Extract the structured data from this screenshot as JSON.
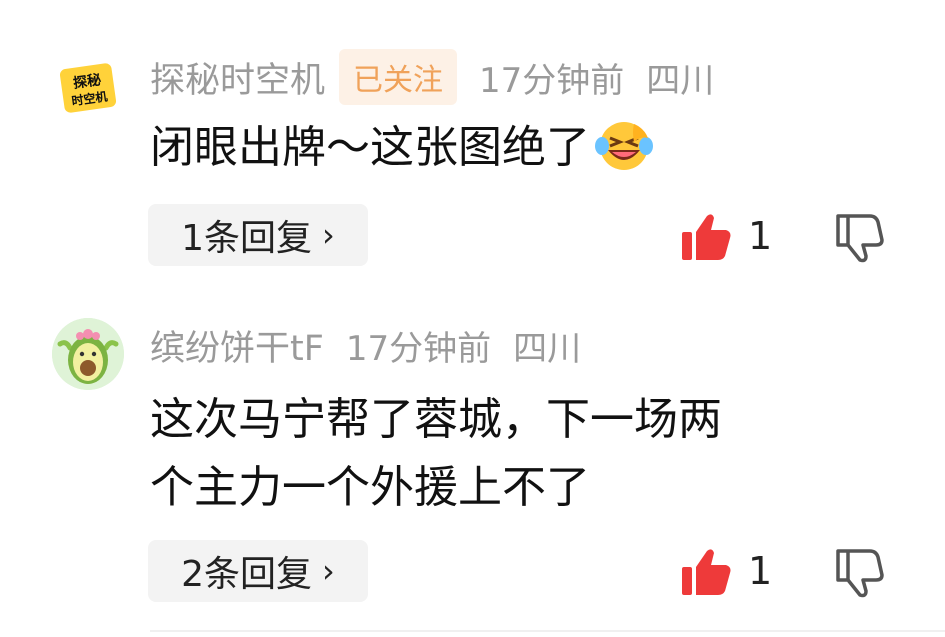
{
  "comments": [
    {
      "username": "探秘时空机",
      "avatar_text": [
        "探秘",
        "时空机"
      ],
      "follow_badge": "已关注",
      "time": "17分钟前",
      "location": "四川",
      "text": "闭眼出牌～这张图绝了",
      "emoji": "laughing-crying-emoji",
      "reply_label": "1条回复",
      "likes": "1"
    },
    {
      "username": "缤纷饼干tF",
      "avatar_icon": "avocado-avatar",
      "time": "17分钟前",
      "location": "四川",
      "text_lines": [
        "这次马宁帮了蓉城，下一场两",
        "个主力一个外援上不了"
      ],
      "reply_label": "2条回复",
      "likes": "1"
    }
  ],
  "colors": {
    "like_red": "#ee3a3a",
    "follow_text": "#f0a25a",
    "meta_gray": "#9a9a9a"
  }
}
